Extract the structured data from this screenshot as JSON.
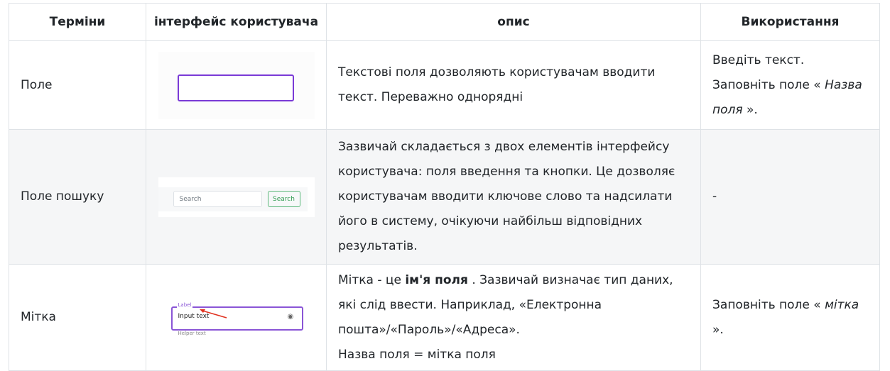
{
  "headers": [
    "Терміни",
    "інтерфейс користувача",
    "опис",
    "Використання"
  ],
  "rows": [
    {
      "term": "Поле",
      "ui": {},
      "description": "Текстові поля дозволяють користувачам вводити текст. Переважно однорядні",
      "usage": {
        "line1": "Введіть текст.",
        "prefix": "Заповніть поле « ",
        "italic": "Назва поля",
        "suffix": " »."
      }
    },
    {
      "term": "Поле пошуку",
      "ui": {
        "input_placeholder": "Search",
        "button_label": "Search"
      },
      "description": "Зазвичай складається з двох елементів інтерфейсу користувача: поля введення та кнопки. Це дозволяє користувачам вводити ключове слово та надсилати його в систему, очікуючи найбільш відповідних результатів.",
      "usage": {
        "text": "-"
      }
    },
    {
      "term": "Мітка",
      "ui": {
        "label": "Label",
        "input_text": "Input text",
        "helper": "Helper text",
        "icon": "eye-icon"
      },
      "description": {
        "pre": "Мітка - це ",
        "bold": "ім'я поля",
        "post": " . Зазвичай визначає тип даних, які слід ввести. Наприклад, «Електронна пошта»/«Пароль»/«Адреса».",
        "line2": "Назва поля = мітка поля"
      },
      "usage": {
        "prefix": "Заповніть поле « ",
        "italic": "мітка",
        "suffix": " »."
      }
    }
  ],
  "colors": {
    "accent_purple": "#7a3ad6",
    "search_green": "#2e9a4e",
    "arrow_red": "#e0301e"
  }
}
